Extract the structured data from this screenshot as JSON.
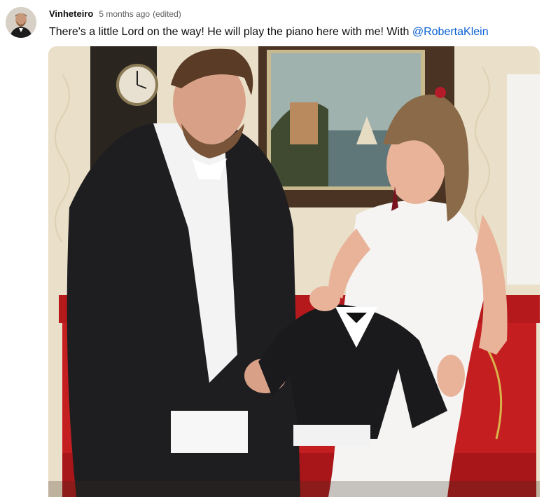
{
  "post": {
    "author": "Vinheteiro",
    "timestamp": "5 months ago",
    "edited": "(edited)",
    "text": "There's a little Lord on the way! He will play the piano here with me! With ",
    "mention": "@RobertaKlein"
  },
  "colors": {
    "mention_link": "#065fd4",
    "author_text": "#0f0f0f",
    "meta_text": "#606060"
  }
}
